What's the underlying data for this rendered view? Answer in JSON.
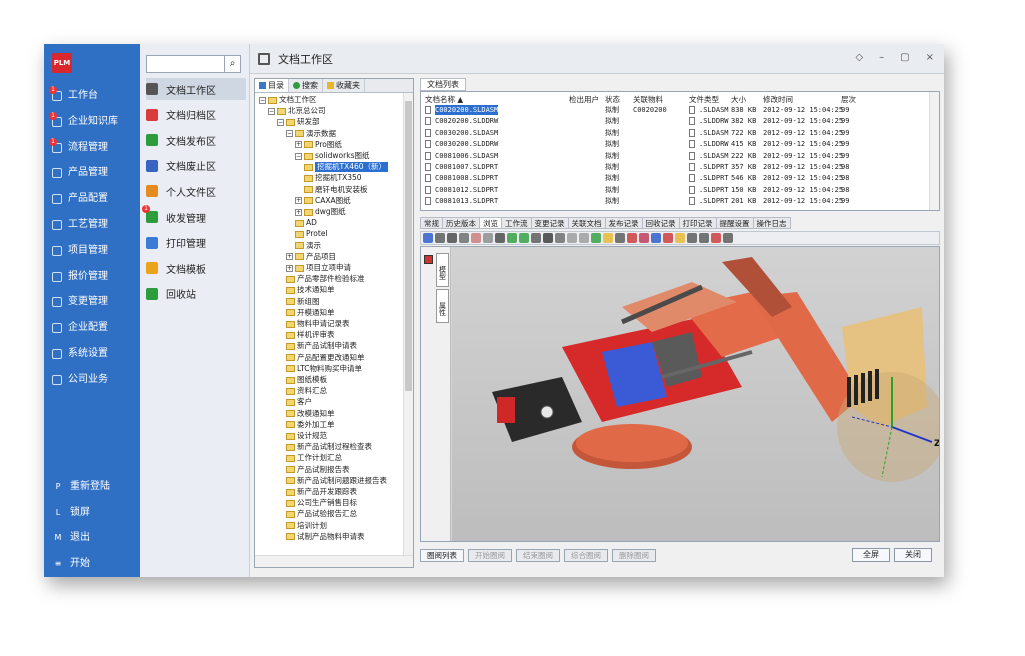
{
  "app": {
    "logo": "PLM",
    "title": "文档工作区"
  },
  "nav": {
    "items": [
      {
        "label": "工作台",
        "badge": "1",
        "icon": "monitor-icon"
      },
      {
        "label": "企业知识库",
        "badge": "1",
        "icon": "book-icon"
      },
      {
        "label": "流程管理",
        "badge": "1",
        "icon": "flow-icon"
      },
      {
        "label": "产品管理",
        "badge": "",
        "icon": "box-icon"
      },
      {
        "label": "产品配置",
        "badge": "",
        "icon": "config-icon"
      },
      {
        "label": "工艺管理",
        "badge": "",
        "icon": "wrench-icon"
      },
      {
        "label": "项目管理",
        "badge": "",
        "icon": "project-icon"
      },
      {
        "label": "报价管理",
        "badge": "",
        "icon": "quote-icon"
      },
      {
        "label": "变更管理",
        "badge": "",
        "icon": "change-icon"
      },
      {
        "label": "企业配置",
        "badge": "",
        "icon": "gear-icon"
      },
      {
        "label": "系统设置",
        "badge": "",
        "icon": "settings-icon"
      },
      {
        "label": "公司业务",
        "badge": "",
        "icon": "grid-icon"
      }
    ],
    "bottom": [
      {
        "key": "P",
        "label": "重新登陆"
      },
      {
        "key": "L",
        "label": "锁屏"
      },
      {
        "key": "M",
        "label": "退出"
      },
      {
        "key": "≡",
        "label": "开始"
      }
    ]
  },
  "sub": {
    "search_placeholder": "",
    "items": [
      {
        "label": "文档工作区",
        "color": "#555555",
        "badge": ""
      },
      {
        "label": "文档归档区",
        "color": "#d93a3a",
        "badge": ""
      },
      {
        "label": "文档发布区",
        "color": "#2c9c3c",
        "badge": ""
      },
      {
        "label": "文档废止区",
        "color": "#3764c0",
        "badge": ""
      },
      {
        "label": "个人文件区",
        "color": "#e58a1f",
        "badge": ""
      },
      {
        "label": "收发管理",
        "color": "#2c9c3c",
        "badge": "1"
      },
      {
        "label": "打印管理",
        "color": "#3b7bd3",
        "badge": ""
      },
      {
        "label": "文档模板",
        "color": "#e9a31c",
        "badge": ""
      },
      {
        "label": "回收站",
        "color": "#2c9c3c",
        "badge": ""
      }
    ]
  },
  "window_buttons": [
    "◇",
    "–",
    "▢",
    "×"
  ],
  "tree": {
    "tabs": [
      "目录",
      "搜索",
      "收藏夹"
    ],
    "nodes": [
      {
        "label": "文档工作区",
        "level": 0,
        "pm": "⊟"
      },
      {
        "label": "北京总公司",
        "level": 1,
        "pm": "⊟"
      },
      {
        "label": "研发部",
        "level": 2,
        "pm": "⊟"
      },
      {
        "label": "演示数据",
        "level": 3,
        "pm": "⊟"
      },
      {
        "label": "Pro图纸",
        "level": 4,
        "pm": "⊞"
      },
      {
        "label": "solidworks图纸",
        "level": 4,
        "pm": "⊟"
      },
      {
        "label": "挖掘机TX460（新）",
        "level": 5,
        "pm": "",
        "sel": true
      },
      {
        "label": "挖掘机TX350",
        "level": 5,
        "pm": ""
      },
      {
        "label": "磨钎电机安装板",
        "level": 5,
        "pm": ""
      },
      {
        "label": "CAXA图纸",
        "level": 4,
        "pm": "⊞"
      },
      {
        "label": "dwg图纸",
        "level": 4,
        "pm": "⊞"
      },
      {
        "label": "AD",
        "level": 4,
        "pm": ""
      },
      {
        "label": "Protel",
        "level": 4,
        "pm": ""
      },
      {
        "label": "演示",
        "level": 4,
        "pm": ""
      },
      {
        "label": "产品项目",
        "level": 3,
        "pm": "⊞"
      },
      {
        "label": "项目立项申请",
        "level": 3,
        "pm": "⊞"
      },
      {
        "label": "产品零部件检验标准",
        "level": 3,
        "pm": ""
      },
      {
        "label": "技术通知单",
        "level": 3,
        "pm": ""
      },
      {
        "label": "新组图",
        "level": 3,
        "pm": ""
      },
      {
        "label": "开模通知单",
        "level": 3,
        "pm": ""
      },
      {
        "label": "物料申请记录表",
        "level": 3,
        "pm": ""
      },
      {
        "label": "样机评审表",
        "level": 3,
        "pm": ""
      },
      {
        "label": "新产品试制申请表",
        "level": 3,
        "pm": ""
      },
      {
        "label": "产品配置更改通知单",
        "level": 3,
        "pm": ""
      },
      {
        "label": "LTC物料购买申请单",
        "level": 3,
        "pm": ""
      },
      {
        "label": "图纸模板",
        "level": 3,
        "pm": ""
      },
      {
        "label": "资料汇总",
        "level": 3,
        "pm": ""
      },
      {
        "label": "客户",
        "level": 3,
        "pm": ""
      },
      {
        "label": "改模通知单",
        "level": 3,
        "pm": ""
      },
      {
        "label": "委外加工单",
        "level": 3,
        "pm": ""
      },
      {
        "label": "设计规范",
        "level": 3,
        "pm": ""
      },
      {
        "label": "新产品试制过程检查表",
        "level": 3,
        "pm": ""
      },
      {
        "label": "工作计划汇总",
        "level": 3,
        "pm": ""
      },
      {
        "label": "产品试制报告表",
        "level": 3,
        "pm": ""
      },
      {
        "label": "新产品试制问题跟进报告表",
        "level": 3,
        "pm": ""
      },
      {
        "label": "新产品开发跟踪表",
        "level": 3,
        "pm": ""
      },
      {
        "label": "公司生产销售目标",
        "level": 3,
        "pm": ""
      },
      {
        "label": "产品试验报告汇总",
        "level": 3,
        "pm": ""
      },
      {
        "label": "培训计划",
        "level": 3,
        "pm": ""
      },
      {
        "label": "试制产品物料申请表",
        "level": 3,
        "pm": ""
      }
    ]
  },
  "doclist": {
    "tab": "文档列表",
    "headers": [
      "文档名称 ▲",
      "检出用户",
      "状态",
      "关联物料",
      "文件类型",
      "大小",
      "修改时间",
      "层次"
    ],
    "rows": [
      {
        "name": "C0020200.SLDASM",
        "user": "",
        "status": "拟制",
        "mat": "C0020200",
        "type": ".SLDASM",
        "size": "838 KB",
        "time": "2012-09-12 15:04:25",
        "level": "99",
        "sel": true
      },
      {
        "name": "C0020200.SLDDRW",
        "user": "",
        "status": "拟制",
        "mat": "",
        "type": ".SLDDRW",
        "size": "382 KB",
        "time": "2012-09-12 15:04:25",
        "level": "99"
      },
      {
        "name": "C0030200.SLDASM",
        "user": "",
        "status": "拟制",
        "mat": "",
        "type": ".SLDASM",
        "size": "722 KB",
        "time": "2012-09-12 15:04:25",
        "level": "99"
      },
      {
        "name": "C0030200.SLDDRW",
        "user": "",
        "status": "拟制",
        "mat": "",
        "type": ".SLDDRW",
        "size": "415 KB",
        "time": "2012-09-12 15:04:25",
        "level": "99"
      },
      {
        "name": "C0081006.SLDASM",
        "user": "",
        "status": "拟制",
        "mat": "",
        "type": ".SLDASM",
        "size": "222 KB",
        "time": "2012-09-12 15:04:25",
        "level": "99"
      },
      {
        "name": "C0081007.SLDPRT",
        "user": "",
        "status": "拟制",
        "mat": "",
        "type": ".SLDPRT",
        "size": "357 KB",
        "time": "2012-09-12 15:04:25",
        "level": "98"
      },
      {
        "name": "C0081008.SLDPRT",
        "user": "",
        "status": "拟制",
        "mat": "",
        "type": ".SLDPRT",
        "size": "546 KB",
        "time": "2012-09-12 15:04:25",
        "level": "98"
      },
      {
        "name": "C0081012.SLDPRT",
        "user": "",
        "status": "拟制",
        "mat": "",
        "type": ".SLDPRT",
        "size": "150 KB",
        "time": "2012-09-12 15:04:25",
        "level": "98"
      },
      {
        "name": "C0081013.SLDPRT",
        "user": "",
        "status": "拟制",
        "mat": "",
        "type": ".SLDPRT",
        "size": "201 KB",
        "time": "2012-09-12 15:04:25",
        "level": "99"
      }
    ]
  },
  "subtabs": [
    "常规",
    "历史版本",
    "浏览",
    "工作流",
    "变更记录",
    "关联文档",
    "发布记录",
    "回收记录",
    "打印记录",
    "提醒设置",
    "操作日志"
  ],
  "viewer": {
    "side_tabs": [
      "模型",
      "属性"
    ],
    "axis_z": "Z"
  },
  "bottom": {
    "buttons": [
      "圈阅列表",
      "开始圈阅",
      "结束圈阅",
      "综合圈阅",
      "删除圈阅"
    ],
    "full": "全屏",
    "close": "关闭"
  }
}
